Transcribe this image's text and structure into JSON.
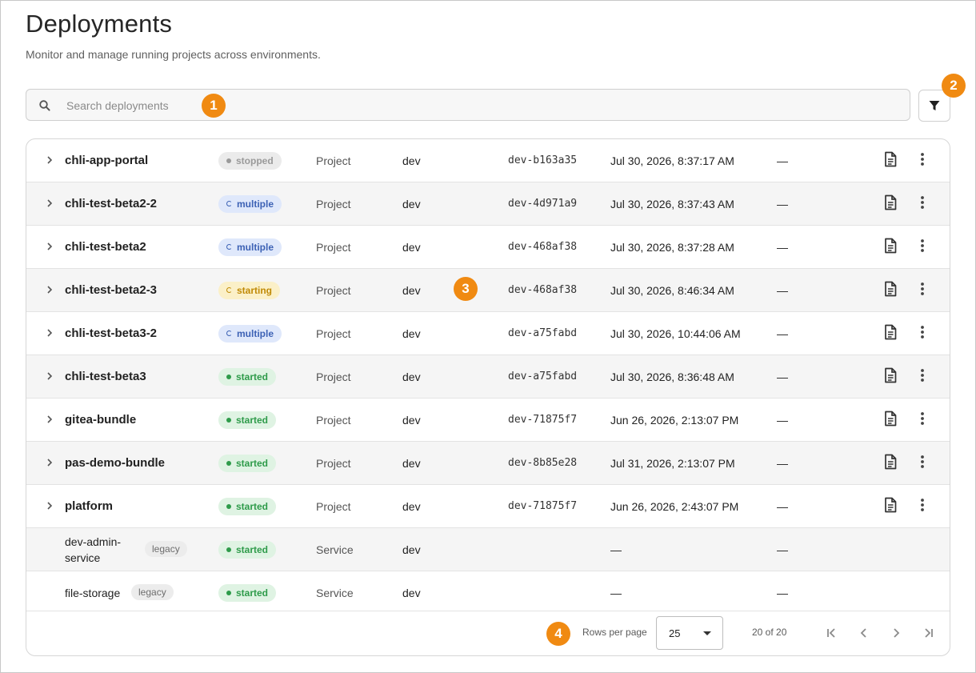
{
  "page": {
    "title": "Deployments",
    "subtitle": "Monitor and manage running projects across environments."
  },
  "search": {
    "placeholder": "Search deployments"
  },
  "callouts": [
    "1",
    "2",
    "3",
    "4"
  ],
  "rows": [
    {
      "name": "chli-app-portal",
      "status": "stopped",
      "type": "Project",
      "env": "dev",
      "rev": "dev-b163a35",
      "updated": "Jul 30, 2026, 8:37:17 AM",
      "extra": "—"
    },
    {
      "name": "chli-test-beta2-2",
      "status": "multiple",
      "type": "Project",
      "env": "dev",
      "rev": "dev-4d971a9",
      "updated": "Jul 30, 2026, 8:37:43 AM",
      "extra": "—"
    },
    {
      "name": "chli-test-beta2",
      "status": "multiple",
      "type": "Project",
      "env": "dev",
      "rev": "dev-468af38",
      "updated": "Jul 30, 2026, 8:37:28 AM",
      "extra": "—"
    },
    {
      "name": "chli-test-beta2-3",
      "status": "starting",
      "type": "Project",
      "env": "dev",
      "rev": "dev-468af38",
      "updated": "Jul 30, 2026, 8:46:34 AM",
      "extra": "—"
    },
    {
      "name": "chli-test-beta3-2",
      "status": "multiple",
      "type": "Project",
      "env": "dev",
      "rev": "dev-a75fabd",
      "updated": "Jul 30, 2026, 10:44:06 AM",
      "extra": "—"
    },
    {
      "name": "chli-test-beta3",
      "status": "started",
      "type": "Project",
      "env": "dev",
      "rev": "dev-a75fabd",
      "updated": "Jul 30, 2026, 8:36:48 AM",
      "extra": "—"
    },
    {
      "name": "gitea-bundle",
      "status": "started",
      "type": "Project",
      "env": "dev",
      "rev": "dev-71875f7",
      "updated": "Jun 26, 2026, 2:13:07 PM",
      "extra": "—"
    },
    {
      "name": "pas-demo-bundle",
      "status": "started",
      "type": "Project",
      "env": "dev",
      "rev": "dev-8b85e28",
      "updated": "Jul 31, 2026, 2:13:07 PM",
      "extra": "—"
    },
    {
      "name": "platform",
      "status": "started",
      "type": "Project",
      "env": "dev",
      "rev": "dev-71875f7",
      "updated": "Jun 26, 2026, 2:43:07 PM",
      "extra": "—"
    },
    {
      "name": "dev-admin-service",
      "tag": "legacy",
      "status": "started",
      "type": "Service",
      "env": "dev",
      "rev": "",
      "updated": "—",
      "extra": "—"
    },
    {
      "name": "file-storage",
      "tag": "legacy",
      "status": "started",
      "type": "Service",
      "env": "dev",
      "rev": "",
      "updated": "—",
      "extra": "—"
    }
  ],
  "pagination": {
    "rows_per_page_label": "Rows per page",
    "rows_per_page": "25",
    "range": "20 of 20"
  },
  "icons": {
    "search": "search-icon",
    "filter": "filter-icon",
    "expand": "chevron-right-icon",
    "logs": "document-icon",
    "more": "more-vertical-icon",
    "first": "first-page-icon",
    "prev": "chevron-left-icon",
    "next": "chevron-right-icon",
    "last": "last-page-icon"
  },
  "colors": {
    "accent": "#f08a12",
    "stopped": "#9a9a9a",
    "multiple": "#3d62b5",
    "starting": "#c08a06",
    "started": "#2e9b4a"
  }
}
